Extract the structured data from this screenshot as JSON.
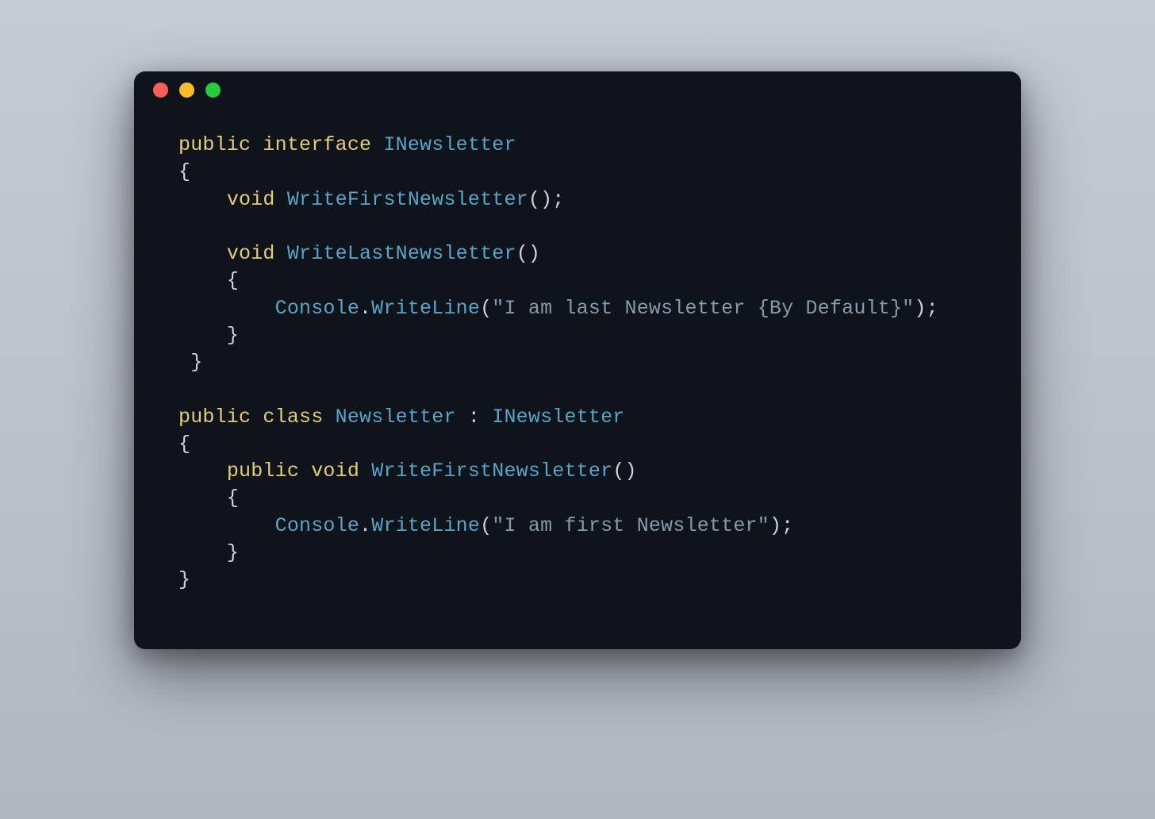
{
  "window": {
    "traffic_lights": [
      "close",
      "minimize",
      "maximize"
    ]
  },
  "code": {
    "lines": [
      [
        {
          "cls": "tok-keyword",
          "txt": "public"
        },
        {
          "cls": "",
          "txt": " "
        },
        {
          "cls": "tok-keyword",
          "txt": "interface"
        },
        {
          "cls": "",
          "txt": " "
        },
        {
          "cls": "tok-type",
          "txt": "INewsletter"
        }
      ],
      [
        {
          "cls": "tok-punct",
          "txt": "{"
        }
      ],
      [
        {
          "cls": "",
          "txt": "    "
        },
        {
          "cls": "tok-keyword",
          "txt": "void"
        },
        {
          "cls": "",
          "txt": " "
        },
        {
          "cls": "tok-method",
          "txt": "WriteFirstNewsletter"
        },
        {
          "cls": "tok-punct",
          "txt": "();"
        }
      ],
      [
        {
          "cls": "",
          "txt": ""
        }
      ],
      [
        {
          "cls": "",
          "txt": "    "
        },
        {
          "cls": "tok-keyword",
          "txt": "void"
        },
        {
          "cls": "",
          "txt": " "
        },
        {
          "cls": "tok-method",
          "txt": "WriteLastNewsletter"
        },
        {
          "cls": "tok-punct",
          "txt": "()"
        }
      ],
      [
        {
          "cls": "",
          "txt": "    "
        },
        {
          "cls": "tok-punct",
          "txt": "{"
        }
      ],
      [
        {
          "cls": "",
          "txt": "        "
        },
        {
          "cls": "tok-type",
          "txt": "Console"
        },
        {
          "cls": "tok-punct",
          "txt": "."
        },
        {
          "cls": "tok-method",
          "txt": "WriteLine"
        },
        {
          "cls": "tok-punct",
          "txt": "("
        },
        {
          "cls": "tok-string",
          "txt": "\"I am last Newsletter {By Default}\""
        },
        {
          "cls": "tok-punct",
          "txt": ");"
        }
      ],
      [
        {
          "cls": "",
          "txt": "    "
        },
        {
          "cls": "tok-punct",
          "txt": "}"
        }
      ],
      [
        {
          "cls": "",
          "txt": " "
        },
        {
          "cls": "tok-punct",
          "txt": "}"
        }
      ],
      [
        {
          "cls": "",
          "txt": ""
        }
      ],
      [
        {
          "cls": "tok-keyword",
          "txt": "public"
        },
        {
          "cls": "",
          "txt": " "
        },
        {
          "cls": "tok-keyword",
          "txt": "class"
        },
        {
          "cls": "",
          "txt": " "
        },
        {
          "cls": "tok-class",
          "txt": "Newsletter"
        },
        {
          "cls": "",
          "txt": " "
        },
        {
          "cls": "tok-punct",
          "txt": ":"
        },
        {
          "cls": "",
          "txt": " "
        },
        {
          "cls": "tok-type",
          "txt": "INewsletter"
        }
      ],
      [
        {
          "cls": "tok-punct",
          "txt": "{"
        }
      ],
      [
        {
          "cls": "",
          "txt": "    "
        },
        {
          "cls": "tok-keyword",
          "txt": "public"
        },
        {
          "cls": "",
          "txt": " "
        },
        {
          "cls": "tok-keyword",
          "txt": "void"
        },
        {
          "cls": "",
          "txt": " "
        },
        {
          "cls": "tok-method",
          "txt": "WriteFirstNewsletter"
        },
        {
          "cls": "tok-punct",
          "txt": "()"
        }
      ],
      [
        {
          "cls": "",
          "txt": "    "
        },
        {
          "cls": "tok-punct",
          "txt": "{"
        }
      ],
      [
        {
          "cls": "",
          "txt": "        "
        },
        {
          "cls": "tok-type",
          "txt": "Console"
        },
        {
          "cls": "tok-punct",
          "txt": "."
        },
        {
          "cls": "tok-method",
          "txt": "WriteLine"
        },
        {
          "cls": "tok-punct",
          "txt": "("
        },
        {
          "cls": "tok-string",
          "txt": "\"I am first Newsletter\""
        },
        {
          "cls": "tok-punct",
          "txt": ");"
        }
      ],
      [
        {
          "cls": "",
          "txt": "    "
        },
        {
          "cls": "tok-punct",
          "txt": "}"
        }
      ],
      [
        {
          "cls": "tok-punct",
          "txt": "}"
        }
      ]
    ]
  }
}
